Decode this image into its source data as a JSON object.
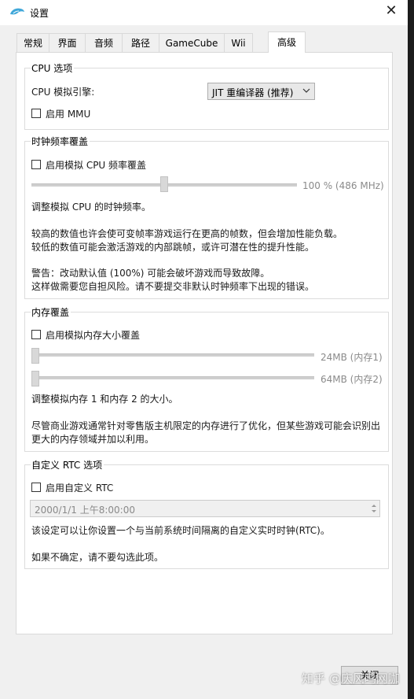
{
  "window": {
    "title": "设置"
  },
  "tabs": [
    {
      "label": "常规"
    },
    {
      "label": "界面"
    },
    {
      "label": "音频"
    },
    {
      "label": "路径"
    },
    {
      "label": "GameCube"
    },
    {
      "label": "Wii"
    },
    {
      "label": "高级"
    }
  ],
  "cpu": {
    "group_title": "CPU 选项",
    "engine_label": "CPU 模拟引擎:",
    "engine_value": "JIT 重编译器 (推荐)",
    "mmu_label": "启用 MMU"
  },
  "clock": {
    "group_title": "时钟频率覆盖",
    "enable_label": "启用模拟 CPU 频率覆盖",
    "slider_value": "100 % (486 MHz)",
    "slider_level_percent": 50,
    "desc1": "调整模拟 CPU 的时钟频率。",
    "desc2": "较高的数值也许会使可变帧率游戏运行在更高的帧数，但会增加性能负载。",
    "desc3": "较低的数值可能会激活游戏的内部跳帧，或许可潜在性的提升性能。",
    "desc4": "警告：改动默认值 (100%) 可能会破坏游戏而导致故障。",
    "desc5": "这样做需要您自担风险。请不要提交非默认时钟频率下出现的错误。"
  },
  "memory": {
    "group_title": "内存覆盖",
    "enable_label": "启用模拟内存大小覆盖",
    "mem1_value": "24MB (内存1)",
    "mem2_value": "64MB (内存2)",
    "desc1": "调整模拟内存 1 和内存 2 的大小。",
    "desc2": "尽管商业游戏通常针对零售版主机限定的内存进行了优化，但某些游戏可能会识别出",
    "desc3": "更大的内存领域并加以利用。"
  },
  "rtc": {
    "group_title": "自定义 RTC 选项",
    "enable_label": "启用自定义 RTC",
    "datetime_value": "2000/1/1 上午8:00:00",
    "desc1": "该设定可以让你设置一个与当前系统时间隔离的自定义实时时钟(RTC)。",
    "desc2": "如果不确定，请不要勾选此项。"
  },
  "buttons": {
    "close": "关闭"
  },
  "watermark": "知乎 @庆风鸣网咖",
  "colors": {
    "window_bg": "#f0f0f0",
    "panel_bg": "#ffffff",
    "disabled_text": "#8a8a8a"
  }
}
